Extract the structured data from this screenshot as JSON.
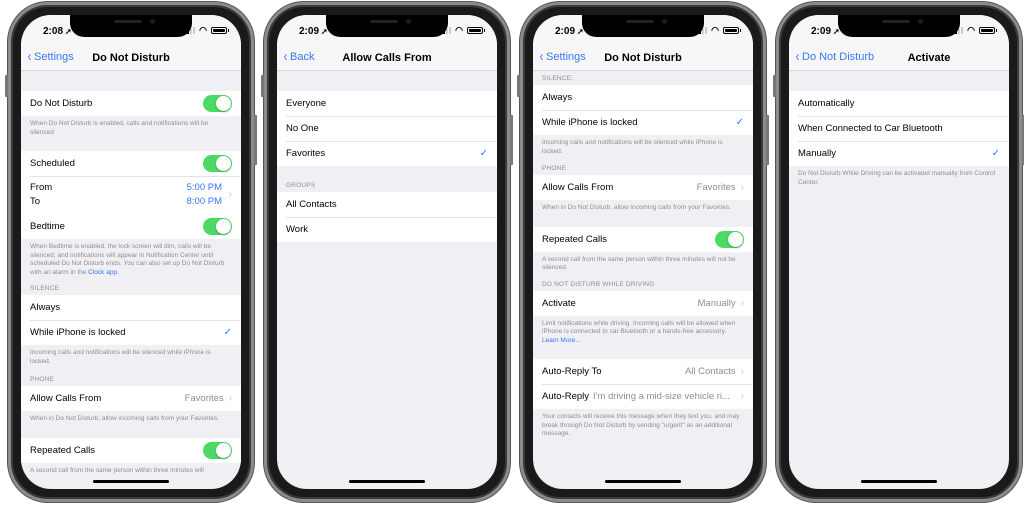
{
  "colors": {
    "accent": "#3478f6",
    "toggle_on": "#4cd964",
    "secondary_text": "#8e8e93",
    "grouped_bg": "#efeff4"
  },
  "phones": [
    {
      "status": {
        "time": "2:08",
        "location_icon": "location-arrow-icon"
      },
      "nav": {
        "back_label": "Settings",
        "title": "Do Not Disturb"
      },
      "dnd_row": {
        "label": "Do Not Disturb",
        "toggle_on": true
      },
      "dnd_footer": "When Do Not Disturb is enabled, calls and notifications will be silenced",
      "scheduled_row": {
        "label": "Scheduled",
        "toggle_on": true
      },
      "schedule": {
        "from_label": "From",
        "from_value": "5:00 PM",
        "to_label": "To",
        "to_value": "8:00 PM"
      },
      "bedtime_row": {
        "label": "Bedtime",
        "toggle_on": true
      },
      "bedtime_footer": "When Bedtime is enabled, the lock screen will dim, calls will be silenced, and notifications will appear in Notification Center until scheduled Do Not Disturb ends. You can also set up Do Not Disturb with an alarm in the ",
      "bedtime_footer_link": "Clock app.",
      "silence_header": "SILENCE",
      "silence_options": [
        {
          "label": "Always",
          "checked": false
        },
        {
          "label": "While iPhone is locked",
          "checked": true
        }
      ],
      "silence_footer": "Incoming calls and notifications will be silenced while iPhone is locked.",
      "phone_header": "PHONE",
      "allow_calls": {
        "label": "Allow Calls From",
        "value": "Favorites"
      },
      "allow_calls_footer": "When in Do Not Disturb, allow incoming calls from your Favorites.",
      "repeated_calls": {
        "label": "Repeated Calls",
        "toggle_on": true
      },
      "repeated_footer": "A second call from the same person within three minutes will"
    },
    {
      "status": {
        "time": "2:09"
      },
      "nav": {
        "back_label": "Back",
        "title": "Allow Calls From"
      },
      "options": [
        {
          "label": "Everyone",
          "checked": false
        },
        {
          "label": "No One",
          "checked": false
        },
        {
          "label": "Favorites",
          "checked": true
        }
      ],
      "groups_header": "GROUPS",
      "groups": [
        {
          "label": "All Contacts"
        },
        {
          "label": "Work"
        }
      ]
    },
    {
      "status": {
        "time": "2:09"
      },
      "nav": {
        "back_label": "Settings",
        "title": "Do Not Disturb"
      },
      "silence_header": "SILENCE:",
      "silence_options": [
        {
          "label": "Always",
          "checked": false
        },
        {
          "label": "While iPhone is locked",
          "checked": true
        }
      ],
      "silence_footer": "Incoming calls and notifications will be silenced while iPhone is locked.",
      "phone_header": "PHONE",
      "allow_calls": {
        "label": "Allow Calls From",
        "value": "Favorites"
      },
      "allow_calls_footer": "When in Do Not Disturb, allow incoming calls from your Favorites.",
      "repeated_calls": {
        "label": "Repeated Calls",
        "toggle_on": true
      },
      "repeated_footer": "A second call from the same person within three minutes will not be silenced.",
      "driving_header": "DO NOT DISTURB WHILE DRIVING",
      "activate": {
        "label": "Activate",
        "value": "Manually"
      },
      "activate_footer": "Limit notifications while driving. Incoming calls will be allowed when iPhone is connected to car Bluetooth or a hands-free accessory. ",
      "activate_footer_link": "Learn More...",
      "auto_reply_to": {
        "label": "Auto-Reply To",
        "value": "All Contacts"
      },
      "auto_reply": {
        "label": "Auto-Reply",
        "value": "I'm driving a mid-size vehicle ri..."
      },
      "auto_reply_footer": "Your contacts will receive this message when they text you, and may break through Do Not Disturb by sending \"urgent\" as an additional message."
    },
    {
      "status": {
        "time": "2:09"
      },
      "nav": {
        "back_label": "Do Not Disturb",
        "title": "Activate"
      },
      "options": [
        {
          "label": "Automatically",
          "checked": false
        },
        {
          "label": "When Connected to Car Bluetooth",
          "checked": false
        },
        {
          "label": "Manually",
          "checked": true
        }
      ],
      "footer": "Do Not Disturb While Driving can be activated manually from Control Center."
    }
  ],
  "glyphs": {
    "checkmark": "✓",
    "chevron_right": "›",
    "chevron_left": "‹",
    "location_arrow": "➚",
    "wifi": "◠"
  }
}
